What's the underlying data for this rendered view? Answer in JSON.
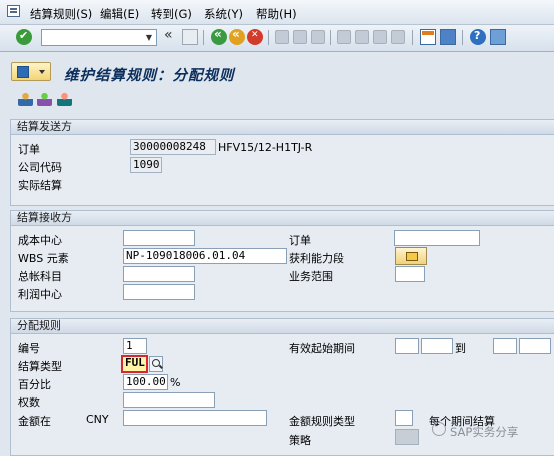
{
  "menu": {
    "items": [
      "结算规则(S)",
      "编辑(E)",
      "转到(G)",
      "系统(Y)",
      "帮助(H)"
    ]
  },
  "toolbar": {
    "command_value": ""
  },
  "title": "维护结算规则：分配规则",
  "sender": {
    "header": "结算发送方",
    "order_label": "订单",
    "order_value": "30000008248",
    "order_desc": "HFV15/12-H1TJ-R",
    "company_label": "公司代码",
    "company_value": "1090",
    "actual_label": "实际结算"
  },
  "receiver": {
    "header": "结算接收方",
    "cost_center_label": "成本中心",
    "cost_center_value": "",
    "order_label": "订单",
    "order_value": "",
    "wbs_label": "WBS 元素",
    "wbs_value": "NP-109018006.01.04",
    "profit_seg_label": "获利能力段",
    "gl_label": "总帐科目",
    "gl_value": "",
    "business_area_label": "业务范围",
    "business_area_value": "",
    "profit_center_label": "利润中心",
    "profit_center_value": ""
  },
  "distribution": {
    "header": "分配规则",
    "number_label": "编号",
    "number_value": "1",
    "valid_from_label": "有效起始期间",
    "valid_to_label": "到",
    "type_label": "结算类型",
    "type_value": "FUL",
    "percent_label": "百分比",
    "percent_value": "100.00",
    "percent_unit": "%",
    "equiv_label": "权数",
    "equiv_value": "",
    "amount_label": "金额在",
    "currency": "CNY",
    "amount_value": "",
    "amount_rule_label": "金额规则类型",
    "per_period_label": "每个期间结算",
    "strategy_label": "策略"
  },
  "watermark": "SAP实务分享"
}
